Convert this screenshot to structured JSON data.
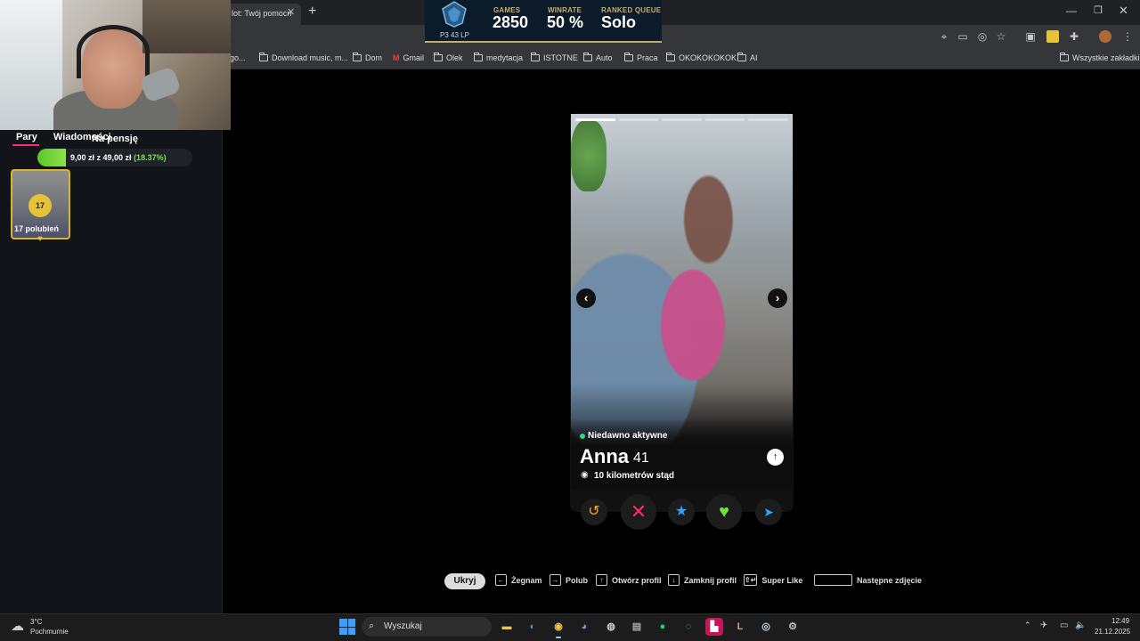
{
  "browser": {
    "active_tab": "lot: Twój pomocn",
    "bookmarks": [
      "go...",
      "Download music, m...",
      "Dom",
      "Gmail",
      "Olek",
      "medytacja",
      "ISTOTNE",
      "Auto",
      "Praca",
      "OKOKOKOKOK",
      "AI"
    ],
    "all_bookmarks": "Wszystkie zakładki"
  },
  "overlay": {
    "lp": "P3 43 LP",
    "games_label": "GAMES",
    "games_value": "2850",
    "winrate_label": "WINRATE",
    "winrate_value": "50 %",
    "queue_label": "RANKED QUEUE",
    "queue_value": "Solo"
  },
  "sidebar": {
    "tabs": [
      "Pary",
      "Wiadomości"
    ],
    "goal_title": "Na pensję",
    "goal_amount": "9,00 zł z 49,00 zł",
    "goal_percent": "(18.37%)",
    "goal_fraction": 0.1837,
    "likes_count": "17",
    "likes_label": "17 polubień"
  },
  "profile": {
    "status": "Niedawno aktywne",
    "name": "Anna",
    "age": "41",
    "distance": "10 kilometrów stąd",
    "photo_count": 5,
    "current_photo": 1
  },
  "hints": {
    "hide_button": "Ukryj",
    "items": [
      {
        "key": "←",
        "label": "Żegnam"
      },
      {
        "key": "→",
        "label": "Polub"
      },
      {
        "key": "↑",
        "label": "Otwórz profil"
      },
      {
        "key": "↓",
        "label": "Zamknij profil"
      },
      {
        "key": "⇧↵",
        "label": "Super Like"
      },
      {
        "key": "",
        "label": "Następne zdjęcie"
      }
    ]
  },
  "taskbar": {
    "weather_temp": "3°C",
    "weather_desc": "Pochmurnie",
    "search_placeholder": "Wyszukaj",
    "time": "12:49",
    "date": "21.12.2025"
  },
  "colors": {
    "nope": "#ff2a6a",
    "like": "#6ee23a",
    "star": "#2aa8ff",
    "undo": "#f5a623",
    "goal": "#5ec42a",
    "overlay_gold": "#c8aa6e"
  }
}
